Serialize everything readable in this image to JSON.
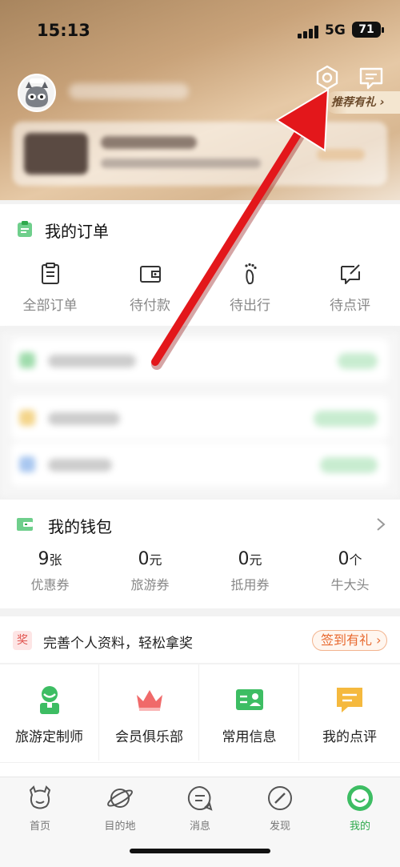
{
  "status_bar": {
    "time": "15:13",
    "network": "5G",
    "battery": "71"
  },
  "header": {
    "gift_tag": "推荐有礼"
  },
  "orders": {
    "title": "我的订单",
    "items": [
      {
        "icon": "clipboard-icon",
        "label": "全部订单"
      },
      {
        "icon": "wallet-icon",
        "label": "待付款"
      },
      {
        "icon": "footprint-icon",
        "label": "待出行"
      },
      {
        "icon": "review-icon",
        "label": "待点评"
      }
    ]
  },
  "wallet": {
    "title": "我的钱包",
    "items": [
      {
        "value": "9",
        "unit": "张",
        "label": "优惠券"
      },
      {
        "value": "0",
        "unit": "元",
        "label": "旅游券"
      },
      {
        "value": "0",
        "unit": "元",
        "label": "抵用券"
      },
      {
        "value": "0",
        "unit": "个",
        "label": "牛大头"
      }
    ]
  },
  "promo": {
    "badge": "奖",
    "text": "完善个人资料，轻松拿奖",
    "button": "签到有礼"
  },
  "services": [
    {
      "icon": "travel-designer-icon",
      "label": "旅游定制师"
    },
    {
      "icon": "crown-icon",
      "label": "会员俱乐部"
    },
    {
      "icon": "id-card-icon",
      "label": "常用信息"
    },
    {
      "icon": "comment-icon",
      "label": "我的点评"
    }
  ],
  "tabs": [
    {
      "icon": "home-cow-icon",
      "label": "首页",
      "active": false
    },
    {
      "icon": "planet-icon",
      "label": "目的地",
      "active": false
    },
    {
      "icon": "message-icon",
      "label": "消息",
      "active": false
    },
    {
      "icon": "compass-icon",
      "label": "发现",
      "active": false
    },
    {
      "icon": "me-icon",
      "label": "我的",
      "active": true
    }
  ],
  "colors": {
    "accent": "#2ea94c",
    "annotation_arrow": "#e3171b",
    "promo": "#e8692f"
  }
}
